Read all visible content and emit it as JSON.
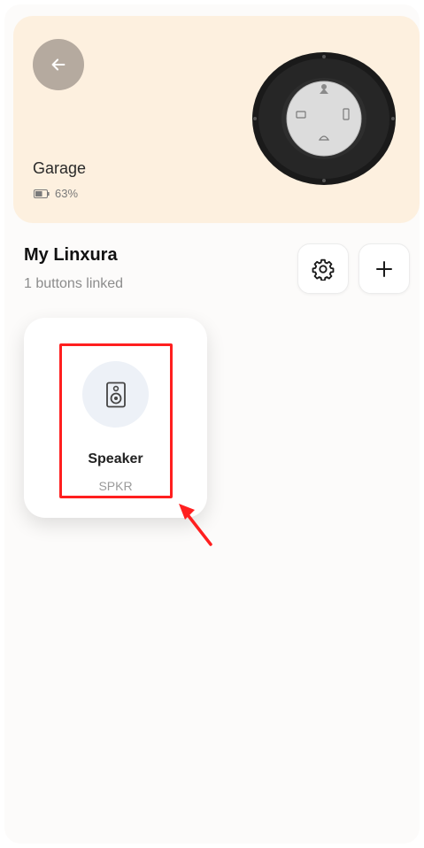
{
  "hero": {
    "device_name": "Garage",
    "battery_level": "63%",
    "battery_fraction": 0.63,
    "background": "#fdf0df"
  },
  "section": {
    "title": "My Linxura",
    "linked_count": "1 buttons linked"
  },
  "buttons": [
    {
      "name": "Speaker",
      "code": "SPKR",
      "icon": "speaker-icon"
    }
  ],
  "icons": {
    "back": "arrow-left-icon",
    "settings": "gear-icon",
    "add": "plus-icon",
    "battery": "battery-icon"
  },
  "colors": {
    "highlight": "#ff1f1f",
    "back_button": "#b5aa9f",
    "icon_circle": "#edf1f7"
  }
}
